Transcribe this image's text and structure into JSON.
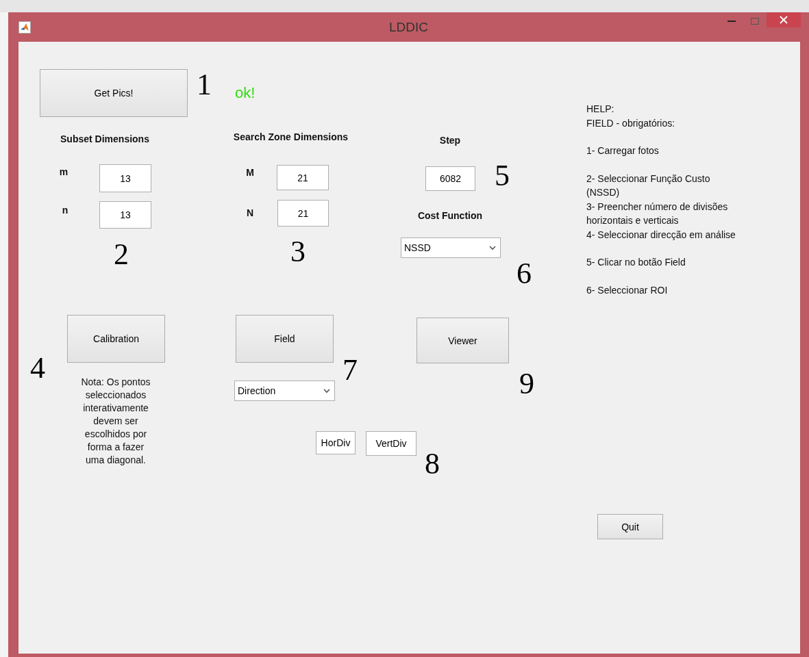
{
  "window": {
    "title": "LDDIC"
  },
  "controls": [
    {
      "kind": "button",
      "label": "Get Pics!"
    },
    {
      "kind": "marker",
      "text": "1"
    },
    {
      "kind": "status",
      "text": "ok!"
    },
    {
      "kind": "heading",
      "text": "Subset Dimensions"
    },
    {
      "kind": "label",
      "text": "m"
    },
    {
      "kind": "edit",
      "value": "13"
    },
    {
      "kind": "label",
      "text": "n"
    },
    {
      "kind": "edit",
      "value": "13"
    },
    {
      "kind": "marker",
      "text": "2"
    },
    {
      "kind": "heading",
      "text": "Search Zone Dimensions"
    },
    {
      "kind": "label",
      "text": "M"
    },
    {
      "kind": "edit",
      "value": "21"
    },
    {
      "kind": "label",
      "text": "N"
    },
    {
      "kind": "edit",
      "value": "21"
    },
    {
      "kind": "marker",
      "text": "3"
    },
    {
      "kind": "heading",
      "text": "Step"
    },
    {
      "kind": "edit",
      "value": "6082"
    },
    {
      "kind": "marker",
      "text": "5"
    },
    {
      "kind": "heading",
      "text": "Cost Function"
    },
    {
      "kind": "popup",
      "value": "NSSD"
    },
    {
      "kind": "marker",
      "text": "6"
    },
    {
      "kind": "help",
      "paragraphs": [
        "HELP:\nFIELD -  obrigatórios:",
        "1- Carregar fotos",
        "2- Seleccionar Função Custo\n(NSSD)\n3- Preencher número de divisões\nhorizontais e verticais\n4- Seleccionar direcção em análise",
        "5- Clicar no botão Field",
        "6- Seleccionar ROI"
      ]
    },
    {
      "kind": "button",
      "label": "Calibration"
    },
    {
      "kind": "marker",
      "text": "4"
    },
    {
      "kind": "note",
      "text": "Nota: Os pontos\nseleccionados\ninterativamente\ndevem ser\nescolhidos por\nforma a fazer\numa diagonal."
    },
    {
      "kind": "button",
      "label": "Field"
    },
    {
      "kind": "marker",
      "text": "7"
    },
    {
      "kind": "popup",
      "value": "Direction"
    },
    {
      "kind": "button",
      "label": "Viewer"
    },
    {
      "kind": "marker",
      "text": "9"
    },
    {
      "kind": "edit",
      "value": "HorDiv"
    },
    {
      "kind": "edit",
      "value": "VertDiv"
    },
    {
      "kind": "marker",
      "text": "8"
    },
    {
      "kind": "button",
      "label": "Quit"
    }
  ]
}
